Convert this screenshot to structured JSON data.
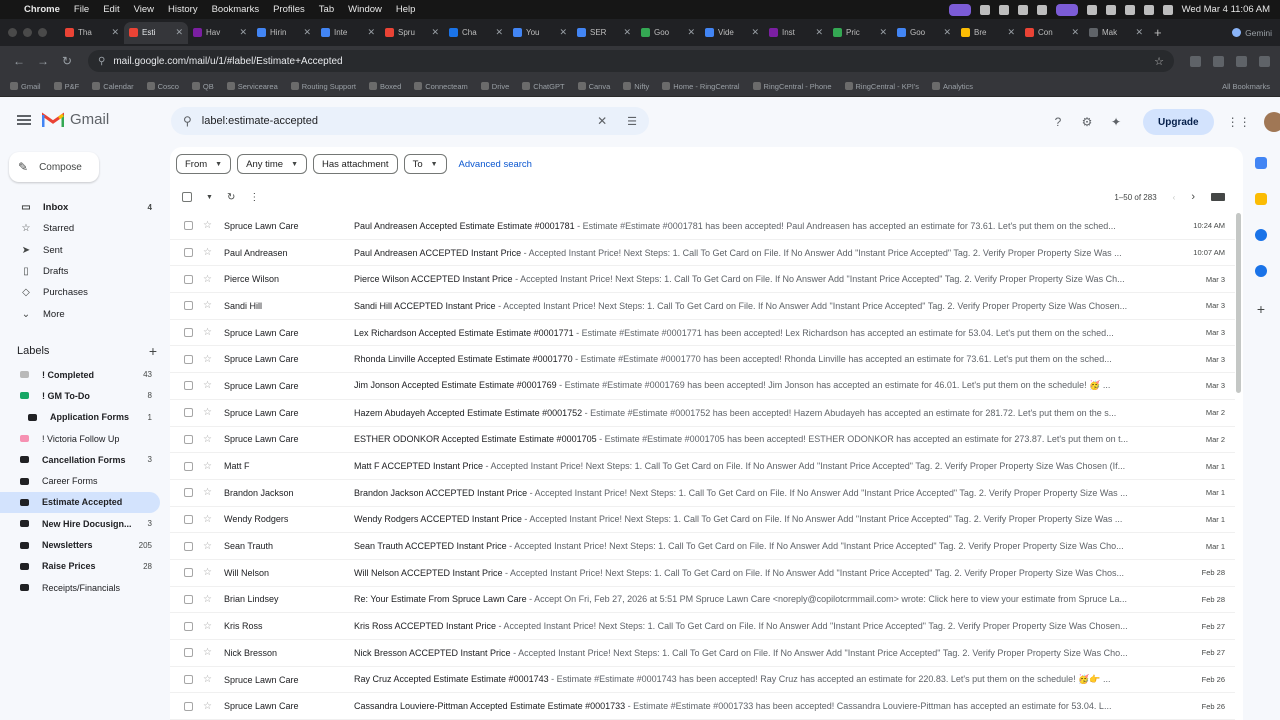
{
  "menubar": {
    "app": "Chrome",
    "menus": [
      "File",
      "Edit",
      "View",
      "History",
      "Bookmarks",
      "Profiles",
      "Tab",
      "Window",
      "Help"
    ],
    "clock": "Wed Mar 4  11:06 AM"
  },
  "tabs": [
    {
      "title": "Tha",
      "color": "#ea4335"
    },
    {
      "title": "Esti",
      "color": "#ea4335"
    },
    {
      "title": "Hav",
      "color": "#7b1fa2"
    },
    {
      "title": "Hirin",
      "color": "#4285f4"
    },
    {
      "title": "Inte",
      "color": "#4285f4"
    },
    {
      "title": "Spru",
      "color": "#ea4335"
    },
    {
      "title": "Cha",
      "color": "#1a73e8"
    },
    {
      "title": "You",
      "color": "#4285f4"
    },
    {
      "title": "SER",
      "color": "#4285f4"
    },
    {
      "title": "Goo",
      "color": "#34a853"
    },
    {
      "title": "Vide",
      "color": "#4285f4"
    },
    {
      "title": "Inst",
      "color": "#7b1fa2"
    },
    {
      "title": "Pric",
      "color": "#34a853"
    },
    {
      "title": "Goo",
      "color": "#4285f4"
    },
    {
      "title": "Bre",
      "color": "#fbbc04"
    },
    {
      "title": "Con",
      "color": "#ea4335"
    },
    {
      "title": "Mak",
      "color": "#5f6368"
    }
  ],
  "tab_profile": "Gemini",
  "address": {
    "url": "mail.google.com/mail/u/1/#label/Estimate+Accepted"
  },
  "bookmarks": [
    "Gmail",
    "P&F",
    "Calendar",
    "Cosco",
    "QB",
    "Servicearea",
    "Routing Support",
    "Boxed",
    "Connecteam",
    "Drive",
    "ChatGPT",
    "Canva",
    "Nifty",
    "Home - RingCentral",
    "RingCentral - Phone",
    "RingCentral - KPI's",
    "Analytics"
  ],
  "bookmarks_all": "All Bookmarks",
  "gmail": {
    "logo": "Gmail",
    "search_value": "label:estimate-accepted",
    "upgrade": "Upgrade",
    "compose": "Compose",
    "nav": [
      {
        "label": "Inbox",
        "count": "4",
        "icon": "inbox-icon",
        "glyph": "▭",
        "bold": true
      },
      {
        "label": "Starred",
        "count": "",
        "icon": "star-icon",
        "glyph": "☆",
        "bold": false
      },
      {
        "label": "Sent",
        "count": "",
        "icon": "send-icon",
        "glyph": "➤",
        "bold": false
      },
      {
        "label": "Drafts",
        "count": "",
        "icon": "draft-icon",
        "glyph": "▯",
        "bold": false
      },
      {
        "label": "Purchases",
        "count": "",
        "icon": "tag-icon",
        "glyph": "◇",
        "bold": false
      },
      {
        "label": "More",
        "count": "",
        "icon": "chevron-down-icon",
        "glyph": "⌄",
        "bold": false
      }
    ],
    "labels_title": "Labels",
    "labels": [
      {
        "label": "! Completed",
        "count": "43",
        "color": "#b9b9b9",
        "bold": true,
        "sub": false,
        "active": false
      },
      {
        "label": "! GM To-Do",
        "count": "8",
        "color": "#16a765",
        "bold": true,
        "sub": false,
        "active": false
      },
      {
        "label": "Application Forms",
        "count": "1",
        "color": "#202124",
        "bold": true,
        "sub": true,
        "active": false
      },
      {
        "label": "! Victoria Follow Up",
        "count": "",
        "color": "#f691b2",
        "bold": false,
        "sub": false,
        "active": false
      },
      {
        "label": "Cancellation Forms",
        "count": "3",
        "color": "#202124",
        "bold": true,
        "sub": false,
        "active": false
      },
      {
        "label": "Career Forms",
        "count": "",
        "color": "#202124",
        "bold": false,
        "sub": false,
        "active": false
      },
      {
        "label": "Estimate Accepted",
        "count": "",
        "color": "#202124",
        "bold": true,
        "sub": false,
        "active": true
      },
      {
        "label": "New Hire Docusign...",
        "count": "3",
        "color": "#202124",
        "bold": true,
        "sub": false,
        "active": false
      },
      {
        "label": "Newsletters",
        "count": "205",
        "color": "#202124",
        "bold": true,
        "sub": false,
        "active": false
      },
      {
        "label": "Raise Prices",
        "count": "28",
        "color": "#202124",
        "bold": true,
        "sub": false,
        "active": false
      },
      {
        "label": "Receipts/Financials",
        "count": "",
        "color": "#202124",
        "bold": false,
        "sub": false,
        "active": false
      }
    ],
    "filters": [
      "From",
      "Any time",
      "Has attachment",
      "To"
    ],
    "advanced_search": "Advanced search",
    "pager": "1–50 of 283",
    "emails": [
      {
        "sender": "Spruce Lawn Care",
        "subject": "Paul Andreasen Accepted Estimate Estimate #0001781",
        "snippet": " - Estimate #Estimate #0001781 has been accepted! Paul Andreasen has accepted an estimate for 73.61. Let's put them on the sched...",
        "date": "10:24 AM"
      },
      {
        "sender": "Paul Andreasen",
        "subject": "Paul Andreasen ACCEPTED Instant Price",
        "snippet": " - Accepted Instant Price! Next Steps: 1. Call To Get Card on File. If No Answer Add \"Instant Price Accepted\" Tag. 2. Verify Proper Property Size Was ...",
        "date": "10:07 AM"
      },
      {
        "sender": "Pierce Wilson",
        "subject": "Pierce Wilson ACCEPTED Instant Price",
        "snippet": " - Accepted Instant Price! Next Steps: 1. Call To Get Card on File. If No Answer Add \"Instant Price Accepted\" Tag. 2. Verify Proper Property Size Was Ch...",
        "date": "Mar 3"
      },
      {
        "sender": "Sandi Hill",
        "subject": "Sandi Hill ACCEPTED Instant Price",
        "snippet": " - Accepted Instant Price! Next Steps: 1. Call To Get Card on File. If No Answer Add \"Instant Price Accepted\" Tag. 2. Verify Proper Property Size Was Chosen...",
        "date": "Mar 3"
      },
      {
        "sender": "Spruce Lawn Care",
        "subject": "Lex Richardson Accepted Estimate Estimate #0001771",
        "snippet": " - Estimate #Estimate #0001771 has been accepted! Lex Richardson has accepted an estimate for 53.04. Let's put them on the sched...",
        "date": "Mar 3"
      },
      {
        "sender": "Spruce Lawn Care",
        "subject": "Rhonda Linville Accepted Estimate Estimate #0001770",
        "snippet": " - Estimate #Estimate #0001770 has been accepted! Rhonda Linville has accepted an estimate for 73.61. Let's put them on the sched...",
        "date": "Mar 3"
      },
      {
        "sender": "Spruce Lawn Care",
        "subject": "Jim Jonson Accepted Estimate Estimate #0001769",
        "snippet": " - Estimate #Estimate #0001769 has been accepted! Jim Jonson has accepted an estimate for 46.01. Let's put them on the schedule! 🥳 ...",
        "date": "Mar 3"
      },
      {
        "sender": "Spruce Lawn Care",
        "subject": "Hazem Abudayeh Accepted Estimate Estimate #0001752",
        "snippet": " - Estimate #Estimate #0001752 has been accepted! Hazem Abudayeh has accepted an estimate for 281.72. Let's put them on the s...",
        "date": "Mar 2"
      },
      {
        "sender": "Spruce Lawn Care",
        "subject": "ESTHER ODONKOR Accepted Estimate Estimate #0001705",
        "snippet": " - Estimate #Estimate #0001705 has been accepted! ESTHER ODONKOR has accepted an estimate for 273.87. Let's put them on t...",
        "date": "Mar 2"
      },
      {
        "sender": "Matt F",
        "subject": "Matt F ACCEPTED Instant Price",
        "snippet": " - Accepted Instant Price! Next Steps: 1. Call To Get Card on File. If No Answer Add \"Instant Price Accepted\" Tag. 2. Verify Proper Property Size Was Chosen (If...",
        "date": "Mar 1"
      },
      {
        "sender": "Brandon Jackson",
        "subject": "Brandon Jackson ACCEPTED Instant Price",
        "snippet": " - Accepted Instant Price! Next Steps: 1. Call To Get Card on File. If No Answer Add \"Instant Price Accepted\" Tag. 2. Verify Proper Property Size Was ...",
        "date": "Mar 1"
      },
      {
        "sender": "Wendy Rodgers",
        "subject": "Wendy Rodgers ACCEPTED Instant Price",
        "snippet": " - Accepted Instant Price! Next Steps: 1. Call To Get Card on File. If No Answer Add \"Instant Price Accepted\" Tag. 2. Verify Proper Property Size Was ...",
        "date": "Mar 1"
      },
      {
        "sender": "Sean Trauth",
        "subject": "Sean Trauth ACCEPTED Instant Price",
        "snippet": " - Accepted Instant Price! Next Steps: 1. Call To Get Card on File. If No Answer Add \"Instant Price Accepted\" Tag. 2. Verify Proper Property Size Was Cho...",
        "date": "Mar 1"
      },
      {
        "sender": "Will Nelson",
        "subject": "Will Nelson ACCEPTED Instant Price",
        "snippet": " - Accepted Instant Price! Next Steps: 1. Call To Get Card on File. If No Answer Add \"Instant Price Accepted\" Tag. 2. Verify Proper Property Size Was Chos...",
        "date": "Feb 28"
      },
      {
        "sender": "Brian Lindsey",
        "subject": "Re: Your Estimate From Spruce Lawn Care",
        "snippet": " - Accept On Fri, Feb 27, 2026 at 5:51 PM Spruce Lawn Care <noreply@copilotcrmmail.com> wrote: Click here to view your estimate from Spruce La...",
        "date": "Feb 28"
      },
      {
        "sender": "Kris Ross",
        "subject": "Kris Ross ACCEPTED Instant Price",
        "snippet": " - Accepted Instant Price! Next Steps: 1. Call To Get Card on File. If No Answer Add \"Instant Price Accepted\" Tag. 2. Verify Proper Property Size Was Chosen...",
        "date": "Feb 27"
      },
      {
        "sender": "Nick Bresson",
        "subject": "Nick Bresson ACCEPTED Instant Price",
        "snippet": " - Accepted Instant Price! Next Steps: 1. Call To Get Card on File. If No Answer Add \"Instant Price Accepted\" Tag. 2. Verify Proper Property Size Was Cho...",
        "date": "Feb 27"
      },
      {
        "sender": "Spruce Lawn Care",
        "subject": "Ray Cruz Accepted Estimate Estimate #0001743",
        "snippet": " - Estimate #Estimate #0001743 has been accepted! Ray Cruz has accepted an estimate for 220.83. Let's put them on the schedule! 🥳👉 ...",
        "date": "Feb 26"
      },
      {
        "sender": "Spruce Lawn Care",
        "subject": "Cassandra Louviere-Pittman Accepted Estimate Estimate #0001733",
        "snippet": " - Estimate #Estimate #0001733 has been accepted! Cassandra Louviere-Pittman has accepted an estimate for 53.04. L...",
        "date": "Feb 26"
      }
    ]
  }
}
